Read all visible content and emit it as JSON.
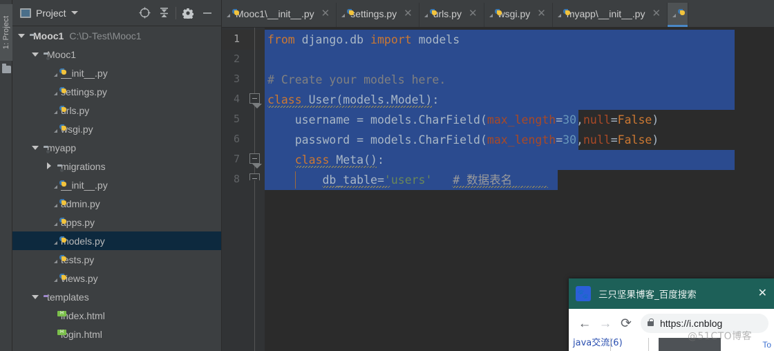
{
  "app": {
    "tool_window_tab": "1: Project",
    "panel_title": "Project",
    "panel_actions": [
      "locate-icon",
      "collapse-all-icon",
      "settings-icon",
      "hide-icon"
    ]
  },
  "project_tree": [
    {
      "label": "Mooc1",
      "path": "C:\\D-Test\\Mooc1",
      "icon": "folder-icon",
      "arrow": "down",
      "indent": 0,
      "bold": true,
      "selected": false
    },
    {
      "label": "Mooc1",
      "path": "",
      "icon": "module-folder-icon",
      "arrow": "down",
      "indent": 1,
      "bold": false,
      "selected": false
    },
    {
      "label": "__init__.py",
      "path": "",
      "icon": "python-file-icon",
      "arrow": "none",
      "indent": 2,
      "bold": false,
      "selected": false
    },
    {
      "label": "settings.py",
      "path": "",
      "icon": "python-file-icon",
      "arrow": "none",
      "indent": 2,
      "bold": false,
      "selected": false
    },
    {
      "label": "urls.py",
      "path": "",
      "icon": "python-file-icon",
      "arrow": "none",
      "indent": 2,
      "bold": false,
      "selected": false
    },
    {
      "label": "wsgi.py",
      "path": "",
      "icon": "python-file-icon",
      "arrow": "none",
      "indent": 2,
      "bold": false,
      "selected": false
    },
    {
      "label": "myapp",
      "path": "",
      "icon": "module-folder-icon",
      "arrow": "down",
      "indent": 1,
      "bold": false,
      "selected": false
    },
    {
      "label": "migrations",
      "path": "",
      "icon": "module-folder-icon",
      "arrow": "right",
      "indent": 2,
      "bold": false,
      "selected": false
    },
    {
      "label": "__init__.py",
      "path": "",
      "icon": "python-file-icon",
      "arrow": "none",
      "indent": 2,
      "bold": false,
      "selected": false
    },
    {
      "label": "admin.py",
      "path": "",
      "icon": "python-file-icon",
      "arrow": "none",
      "indent": 2,
      "bold": false,
      "selected": false
    },
    {
      "label": "apps.py",
      "path": "",
      "icon": "python-file-icon",
      "arrow": "none",
      "indent": 2,
      "bold": false,
      "selected": false
    },
    {
      "label": "models.py",
      "path": "",
      "icon": "python-file-icon",
      "arrow": "none",
      "indent": 2,
      "bold": false,
      "selected": true
    },
    {
      "label": "tests.py",
      "path": "",
      "icon": "python-file-icon",
      "arrow": "none",
      "indent": 2,
      "bold": false,
      "selected": false
    },
    {
      "label": "views.py",
      "path": "",
      "icon": "python-file-icon",
      "arrow": "none",
      "indent": 2,
      "bold": false,
      "selected": false
    },
    {
      "label": "templates",
      "path": "",
      "icon": "purple-folder-icon",
      "arrow": "down",
      "indent": 1,
      "bold": false,
      "selected": false
    },
    {
      "label": "index.html",
      "path": "",
      "icon": "html-file-icon",
      "arrow": "none",
      "indent": 2,
      "bold": false,
      "selected": false
    },
    {
      "label": "login.html",
      "path": "",
      "icon": "html-file-icon",
      "arrow": "none",
      "indent": 2,
      "bold": false,
      "selected": false
    }
  ],
  "editor_tabs": [
    {
      "label": "Mooc1\\__init__.py",
      "active": false,
      "closable": true
    },
    {
      "label": "settings.py",
      "active": false,
      "closable": true
    },
    {
      "label": "urls.py",
      "active": false,
      "closable": true
    },
    {
      "label": "wsgi.py",
      "active": false,
      "closable": true
    },
    {
      "label": "myapp\\__init__.py",
      "active": false,
      "closable": true
    },
    {
      "label": "",
      "active": true,
      "closable": false
    }
  ],
  "code": {
    "line_numbers": [
      "1",
      "2",
      "3",
      "4",
      "5",
      "6",
      "7",
      "8"
    ],
    "current_line": "1",
    "lines": [
      {
        "n": 1,
        "selected": true,
        "tokens": [
          {
            "t": "from",
            "c": "kw"
          },
          {
            "t": " django.db ",
            "c": "def"
          },
          {
            "t": "import",
            "c": "kw"
          },
          {
            "t": " models",
            "c": "def"
          }
        ]
      },
      {
        "n": 2,
        "selected": true,
        "tokens": []
      },
      {
        "n": 3,
        "selected": true,
        "tokens": [
          {
            "t": "# Create your models here.",
            "c": "cmt"
          }
        ]
      },
      {
        "n": 4,
        "selected": true,
        "tokens": [
          {
            "t": "class",
            "c": "kw"
          },
          {
            "t": " User(models.Model):",
            "c": "def"
          }
        ]
      },
      {
        "n": 5,
        "selected": true,
        "tokens": [
          {
            "t": "    username = models.CharField(",
            "c": "def"
          },
          {
            "t": "max_length",
            "c": "kwarg"
          },
          {
            "t": "=",
            "c": "def"
          },
          {
            "t": "30",
            "c": "num"
          },
          {
            "t": ",",
            "c": "def"
          },
          {
            "t": "null",
            "c": "kwarg"
          },
          {
            "t": "=",
            "c": "def"
          },
          {
            "t": "False",
            "c": "kw"
          },
          {
            "t": ")",
            "c": "def"
          }
        ]
      },
      {
        "n": 6,
        "selected": true,
        "tokens": [
          {
            "t": "    password = models.CharField(",
            "c": "def"
          },
          {
            "t": "max_length",
            "c": "kwarg"
          },
          {
            "t": "=",
            "c": "def"
          },
          {
            "t": "30",
            "c": "num"
          },
          {
            "t": ",",
            "c": "def"
          },
          {
            "t": "null",
            "c": "kwarg"
          },
          {
            "t": "=",
            "c": "def"
          },
          {
            "t": "False",
            "c": "kw"
          },
          {
            "t": ")",
            "c": "def"
          }
        ]
      },
      {
        "n": 7,
        "selected": true,
        "tokens": [
          {
            "t": "    ",
            "c": "def"
          },
          {
            "t": "class",
            "c": "kw"
          },
          {
            "t": " Meta():",
            "c": "def"
          }
        ]
      },
      {
        "n": 8,
        "selected": true,
        "tokens": [
          {
            "t": "        db_table=",
            "c": "def"
          },
          {
            "t": "'users'",
            "c": "str"
          },
          {
            "t": "   ",
            "c": "def"
          },
          {
            "t": "# 数据表名",
            "c": "cmt2"
          }
        ]
      }
    ]
  },
  "browser": {
    "title": "三只坚果博客_百度搜索",
    "close_label": "✕",
    "back_label": "←",
    "forward_label": "→",
    "reload_label": "⟳",
    "url": "https://i.cnblog",
    "page_snippet": "java交流(6)",
    "page_button": "To"
  },
  "watermark": "@51CTO博客",
  "colors": {
    "ide_chrome": "#3c3f41",
    "editor_bg": "#2b2b2b",
    "gutter_bg": "#313335",
    "selection_blue": "#2b4b8f",
    "tree_selected": "#0d293e",
    "tab_active_underline": "#4a88c7",
    "browser_titlebar": "#1d6058",
    "keyword_orange": "#cc7832",
    "string_green": "#6a8759",
    "number_blue": "#6897bb"
  }
}
